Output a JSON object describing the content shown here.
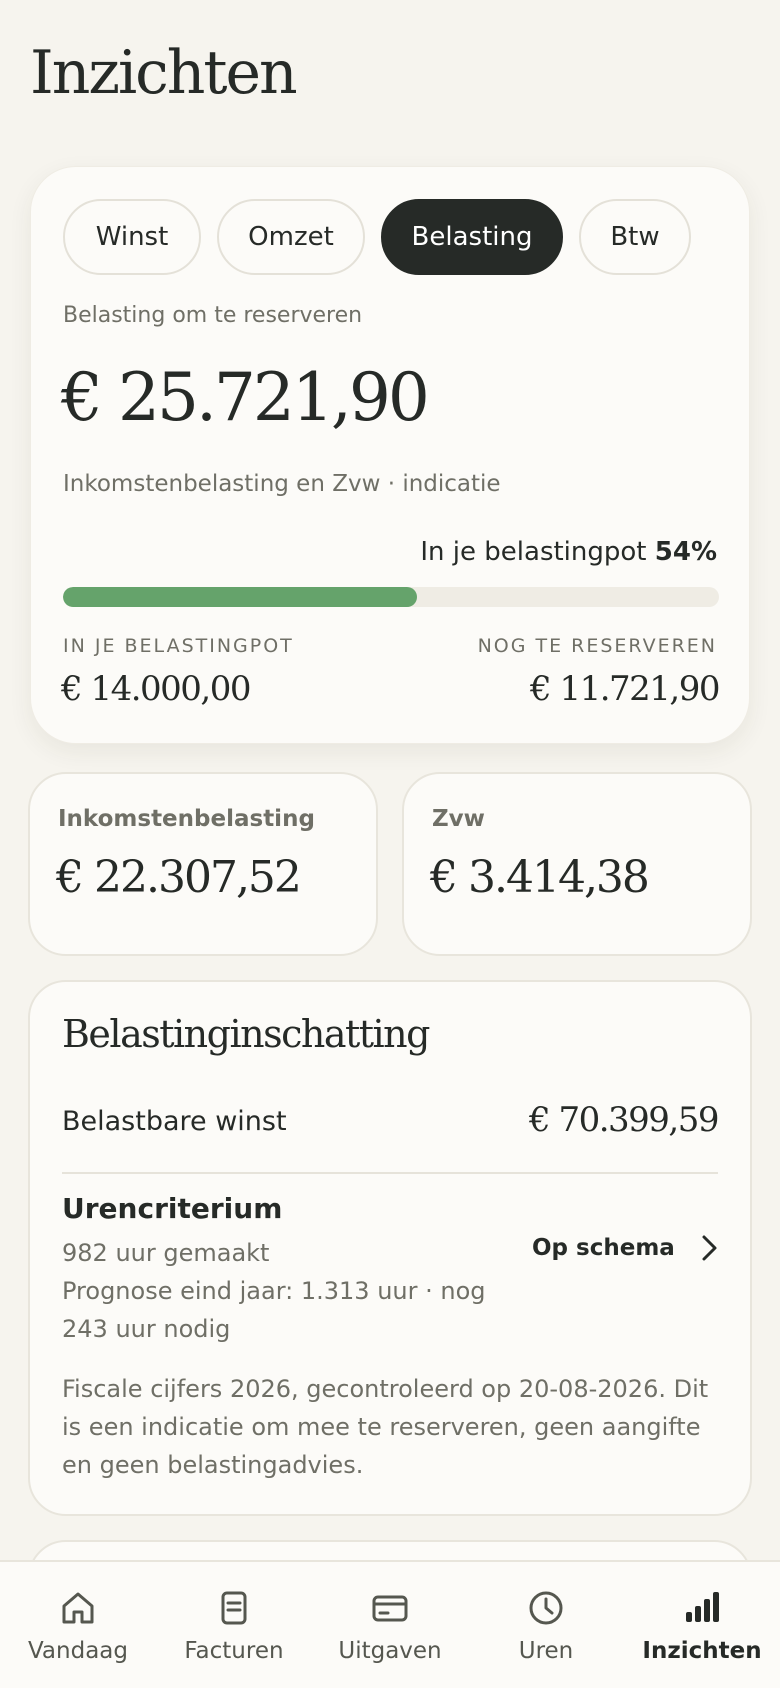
{
  "page": {
    "title": "Inzichten"
  },
  "tabs": [
    {
      "label": "Winst"
    },
    {
      "label": "Omzet"
    },
    {
      "label": "Belasting"
    },
    {
      "label": "Btw"
    }
  ],
  "active_tab": "Belasting",
  "summary": {
    "label": "Belasting om te reserveren",
    "amount": "€ 25.721,90",
    "indication": "Inkomstenbelasting en Zvw · indicatie",
    "pot_text": "In je belastingpot",
    "pot_percent": "54%",
    "progress_fraction": 0.54,
    "left_caption": "IN JE BELASTINGPOT",
    "left_amount": "€ 14.000,00",
    "right_caption": "NOG TE RESERVEREN",
    "right_amount": "€ 11.721,90"
  },
  "cards": {
    "inkomsten": {
      "label": "Inkomstenbelasting",
      "amount": "€ 22.307,52"
    },
    "zvw": {
      "label": "Zvw",
      "amount": "€ 3.414,38"
    }
  },
  "estimate": {
    "title": "Belastinginschatting",
    "profit_label": "Belastbare winst",
    "profit_value": "€ 70.399,59",
    "uren_title": "Urencriterium",
    "uren_made": "982 uur gemaakt",
    "uren_forecast": "Prognose eind jaar: 1.313 uur · nog 243 uur nodig",
    "status": "Op schema",
    "disclaimer": "Fiscale cijfers 2026, gecontroleerd op 20-08-2026. Dit is een indicatie om mee te reserveren, geen aangifte en geen belastingadvies."
  },
  "nav": [
    {
      "label": "Vandaag",
      "icon": "home-icon"
    },
    {
      "label": "Facturen",
      "icon": "document-icon"
    },
    {
      "label": "Uitgaven",
      "icon": "card-icon"
    },
    {
      "label": "Uren",
      "icon": "clock-icon"
    },
    {
      "label": "Inzichten",
      "icon": "bar-chart-icon"
    }
  ],
  "colors": {
    "background": "#f6f4ee",
    "accent_dark": "#262a27",
    "progress_green": "#65a36b"
  }
}
